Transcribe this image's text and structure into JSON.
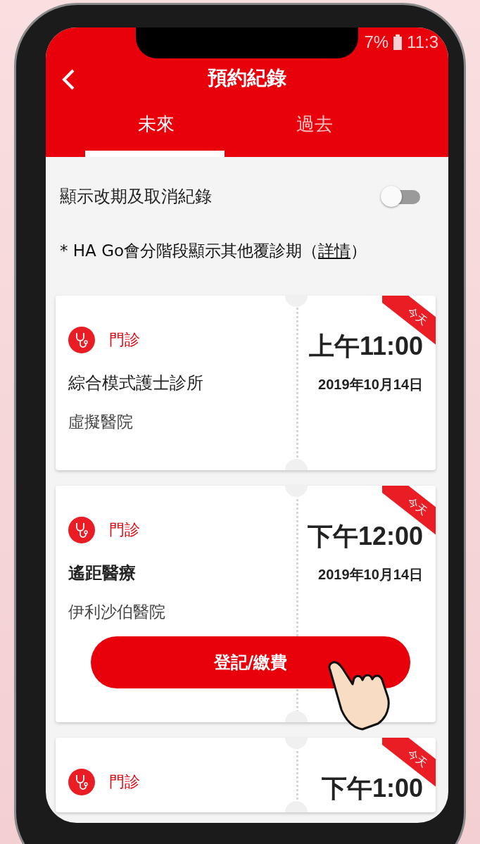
{
  "status": {
    "battery": "7%",
    "time": "11:3"
  },
  "header": {
    "title": "預約紀錄"
  },
  "tabs": [
    {
      "label": "未來",
      "selected": true
    },
    {
      "label": "過去",
      "selected": false
    }
  ],
  "toggle": {
    "label": "顯示改期及取消紀錄",
    "on": false
  },
  "note": {
    "text": "* HA Go會分階段顯示其他覆診期（",
    "link": "詳情",
    "end": "）"
  },
  "appointments": [
    {
      "type": "門診",
      "clinic": "綜合模式護士診所",
      "clinic_bold": false,
      "hospital": "虛擬醫院",
      "time": "上午11:00",
      "date": "2019年10月14日",
      "badge": "今天"
    },
    {
      "type": "門診",
      "clinic": "遙距醫療",
      "clinic_bold": true,
      "hospital": "伊利沙伯醫院",
      "time": "下午12:00",
      "date": "2019年10月14日",
      "badge": "今天",
      "button": "登記/繳費"
    },
    {
      "type": "門診",
      "time": "下午1:00",
      "badge": "今天"
    }
  ]
}
